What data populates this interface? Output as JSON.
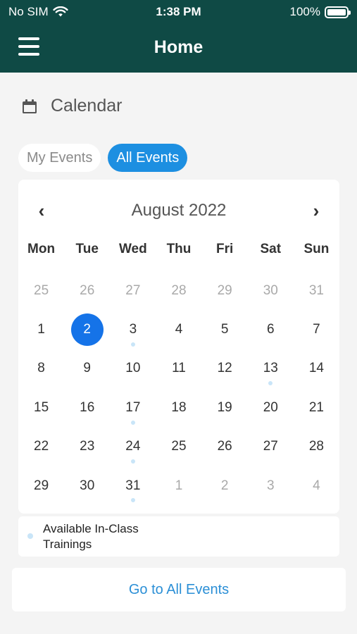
{
  "status_bar": {
    "carrier": "No SIM",
    "time": "1:38 PM",
    "battery": "100%"
  },
  "nav": {
    "title": "Home"
  },
  "section": {
    "title": "Calendar"
  },
  "toggle": {
    "my_events": "My Events",
    "all_events": "All Events",
    "active": "all_events"
  },
  "calendar": {
    "month_label": "August 2022",
    "prev_icon": "chevron-left-icon",
    "next_icon": "chevron-right-icon",
    "weekdays": [
      "Mon",
      "Tue",
      "Wed",
      "Thu",
      "Fri",
      "Sat",
      "Sun"
    ],
    "days": [
      {
        "n": "25",
        "muted": true
      },
      {
        "n": "26",
        "muted": true
      },
      {
        "n": "27",
        "muted": true
      },
      {
        "n": "28",
        "muted": true
      },
      {
        "n": "29",
        "muted": true
      },
      {
        "n": "30",
        "muted": true
      },
      {
        "n": "31",
        "muted": true
      },
      {
        "n": "1"
      },
      {
        "n": "2",
        "selected": true
      },
      {
        "n": "3",
        "dot": true
      },
      {
        "n": "4"
      },
      {
        "n": "5"
      },
      {
        "n": "6"
      },
      {
        "n": "7"
      },
      {
        "n": "8"
      },
      {
        "n": "9"
      },
      {
        "n": "10"
      },
      {
        "n": "11"
      },
      {
        "n": "12"
      },
      {
        "n": "13",
        "dot": true
      },
      {
        "n": "14"
      },
      {
        "n": "15"
      },
      {
        "n": "16"
      },
      {
        "n": "17",
        "dot": true
      },
      {
        "n": "18"
      },
      {
        "n": "19"
      },
      {
        "n": "20"
      },
      {
        "n": "21"
      },
      {
        "n": "22"
      },
      {
        "n": "23"
      },
      {
        "n": "24",
        "dot": true
      },
      {
        "n": "25"
      },
      {
        "n": "26"
      },
      {
        "n": "27"
      },
      {
        "n": "28"
      },
      {
        "n": "29"
      },
      {
        "n": "30"
      },
      {
        "n": "31",
        "dot": true
      },
      {
        "n": "1",
        "muted": true
      },
      {
        "n": "2",
        "muted": true
      },
      {
        "n": "3",
        "muted": true
      },
      {
        "n": "4",
        "muted": true
      }
    ]
  },
  "legend": {
    "label": "Available In-Class Trainings",
    "dot_color": "#c9e5f8"
  },
  "footer": {
    "go_all_events": "Go to All Events"
  },
  "colors": {
    "header_bg": "#0f4a45",
    "accent": "#1d8fe1",
    "selected": "#1573e8",
    "link": "#2b8fd6"
  }
}
